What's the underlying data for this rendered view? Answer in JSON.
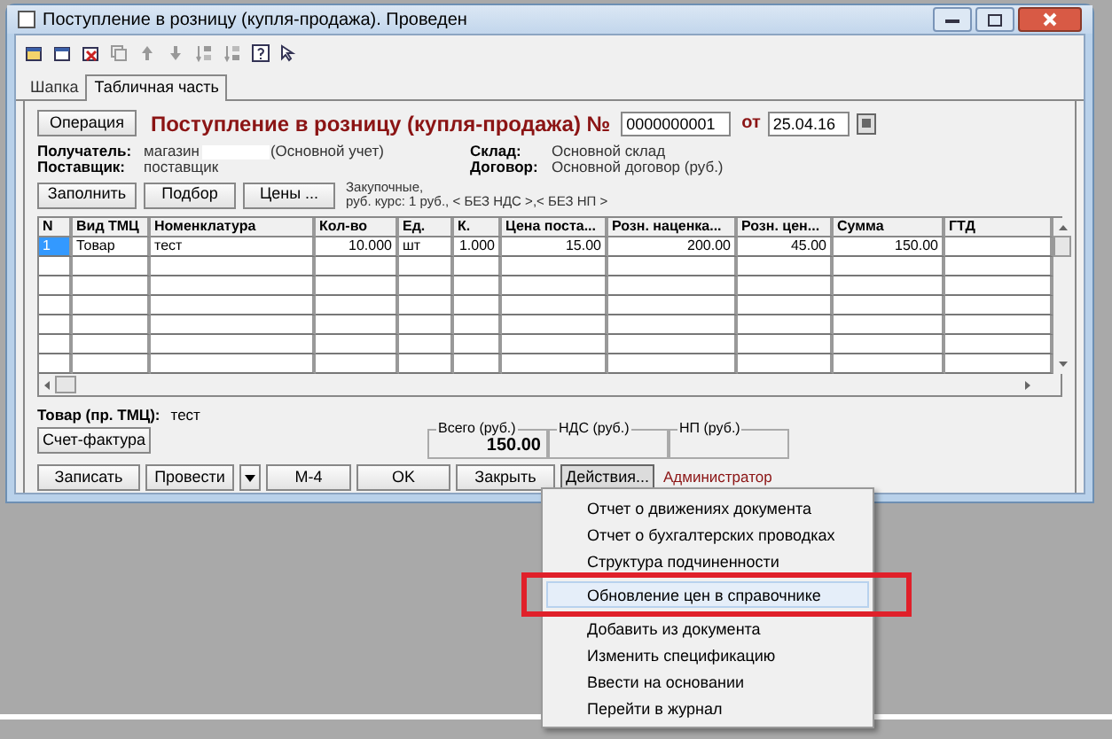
{
  "window": {
    "title": "Поступление в розницу (купля-продажа). Проведен"
  },
  "tabs": [
    {
      "label": "Шапка",
      "selected": false
    },
    {
      "label": "Табличная часть",
      "selected": true
    }
  ],
  "header": {
    "operation_button": "Операция",
    "doc_title": "Поступление в розницу (купля-продажа) №",
    "number": "0000000001",
    "date_label": "от",
    "date": "25.04.16"
  },
  "left_fields": [
    {
      "label": "Получатель:",
      "value": "магазин",
      "note": "(Основной учет)"
    },
    {
      "label": "Поставщик:",
      "value": "поставщик"
    }
  ],
  "right_fields": [
    {
      "label": "Склад:",
      "value": "Основной склад"
    },
    {
      "label": "Договор:",
      "value": "Основной договор (руб.)"
    }
  ],
  "table_buttons": [
    "Заполнить",
    "Подбор",
    "Цены ..."
  ],
  "price_info": [
    "Закупочные,",
    "руб. курс: 1 руб., < БЕЗ НДС >,< БЕЗ НП >"
  ],
  "table": {
    "columns": [
      "N",
      "Вид ТМЦ",
      "Номенклатура",
      "Кол-во",
      "Ед.",
      "К.",
      "Цена поста...",
      "Розн. наценка...",
      "Розн. цен...",
      "Сумма",
      "ГТД"
    ],
    "rows": [
      {
        "cells": [
          "1",
          "Товар",
          "тест",
          "10.000",
          "шт",
          "1.000",
          "15.00",
          "200.00",
          "45.00",
          "150.00"
        ],
        "selected": true
      }
    ]
  },
  "item_caption": {
    "label": "Товар (пр. ТМЦ):",
    "value": "тест"
  },
  "invoice_button": "Счет-фактура",
  "totals": [
    {
      "label": "Всего (руб.)",
      "value": "150.00"
    },
    {
      "label": "НДС (руб.)"
    },
    {
      "label": "НП (руб.)"
    }
  ],
  "actions": [
    {
      "kind": "button",
      "label": "Записать"
    },
    {
      "kind": "button",
      "label": "Провести"
    },
    {
      "kind": "dropdown"
    },
    {
      "kind": "button",
      "label": "М-4"
    },
    {
      "kind": "button",
      "label": "OK"
    },
    {
      "kind": "button",
      "label": "Закрыть"
    },
    {
      "kind": "menu",
      "label": "Действия...",
      "expanded": true
    }
  ],
  "user": "Администратор",
  "context_menu": {
    "items": [
      {
        "label": "Отчет о движениях документа",
        "selected": false,
        "annotated": false
      },
      {
        "label": "Отчет о бухгалтерских проводках",
        "selected": false,
        "annotated": false
      },
      {
        "label": "Структура подчиненности",
        "selected": false,
        "annotated": false
      },
      {
        "label": "Обновление цен в справочнике",
        "selected": true,
        "annotated": true
      },
      {
        "label": "Добавить из документа",
        "selected": false,
        "annotated": false
      },
      {
        "label": "Изменить спецификацию",
        "selected": false,
        "annotated": false
      },
      {
        "label": "Ввести на основании",
        "selected": false,
        "annotated": false
      },
      {
        "label": "Перейти в журнал",
        "selected": false,
        "annotated": false
      }
    ]
  }
}
